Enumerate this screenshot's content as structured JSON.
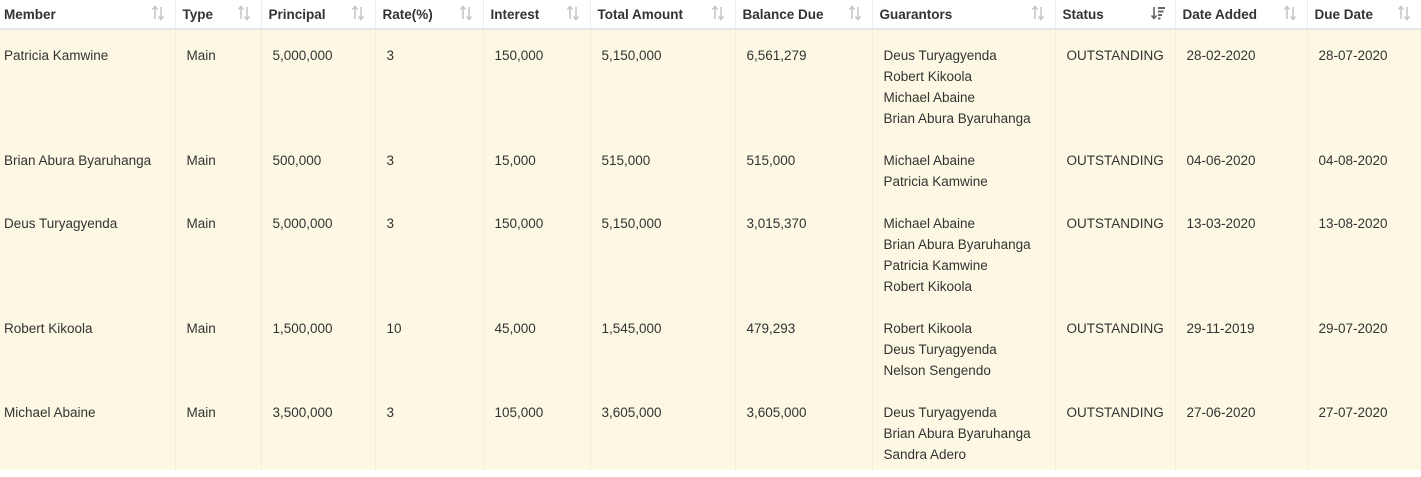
{
  "columns": [
    {
      "label": "Member",
      "sort": "unsorted"
    },
    {
      "label": "Type",
      "sort": "unsorted"
    },
    {
      "label": "Principal",
      "sort": "unsorted"
    },
    {
      "label": "Rate(%)",
      "sort": "unsorted"
    },
    {
      "label": "Interest",
      "sort": "unsorted"
    },
    {
      "label": "Total Amount",
      "sort": "unsorted"
    },
    {
      "label": "Balance Due",
      "sort": "unsorted"
    },
    {
      "label": "Guarantors",
      "sort": "unsorted"
    },
    {
      "label": "Status",
      "sort": "descending"
    },
    {
      "label": "Date Added",
      "sort": "unsorted"
    },
    {
      "label": "Due Date",
      "sort": "unsorted"
    }
  ],
  "rows": [
    {
      "member": "Patricia Kamwine",
      "type": "Main",
      "principal": "5,000,000",
      "rate": "3",
      "interest": "150,000",
      "total": "5,150,000",
      "balance": "6,561,279",
      "guarantors": [
        "Deus Turyagyenda",
        "Robert Kikoola",
        "Michael Abaine",
        "Brian Abura Byaruhanga"
      ],
      "status": "OUTSTANDING",
      "date_added": "28-02-2020",
      "due_date": "28-07-2020"
    },
    {
      "member": "Brian Abura Byaruhanga",
      "type": "Main",
      "principal": "500,000",
      "rate": "3",
      "interest": "15,000",
      "total": "515,000",
      "balance": "515,000",
      "guarantors": [
        "Michael Abaine",
        "Patricia Kamwine"
      ],
      "status": "OUTSTANDING",
      "date_added": "04-06-2020",
      "due_date": "04-08-2020"
    },
    {
      "member": "Deus Turyagyenda",
      "type": "Main",
      "principal": "5,000,000",
      "rate": "3",
      "interest": "150,000",
      "total": "5,150,000",
      "balance": "3,015,370",
      "guarantors": [
        "Michael Abaine",
        "Brian Abura Byaruhanga",
        "Patricia Kamwine",
        "Robert Kikoola"
      ],
      "status": "OUTSTANDING",
      "date_added": "13-03-2020",
      "due_date": "13-08-2020"
    },
    {
      "member": "Robert Kikoola",
      "type": "Main",
      "principal": "1,500,000",
      "rate": "10",
      "interest": "45,000",
      "total": "1,545,000",
      "balance": "479,293",
      "guarantors": [
        "Robert Kikoola",
        "Deus Turyagyenda",
        "Nelson Sengendo"
      ],
      "status": "OUTSTANDING",
      "date_added": "29-11-2019",
      "due_date": "29-07-2020"
    },
    {
      "member": "Michael Abaine",
      "type": "Main",
      "principal": "3,500,000",
      "rate": "3",
      "interest": "105,000",
      "total": "3,605,000",
      "balance": "3,605,000",
      "guarantors": [
        "Deus Turyagyenda",
        "Brian Abura Byaruhanga",
        "Sandra Adero"
      ],
      "status": "OUTSTANDING",
      "date_added": "27-06-2020",
      "due_date": "27-07-2020"
    }
  ],
  "colors": {
    "row_bg": "#fcf8e3",
    "sort_icon": "#c8c8c8",
    "sort_icon_active": "#666666"
  }
}
